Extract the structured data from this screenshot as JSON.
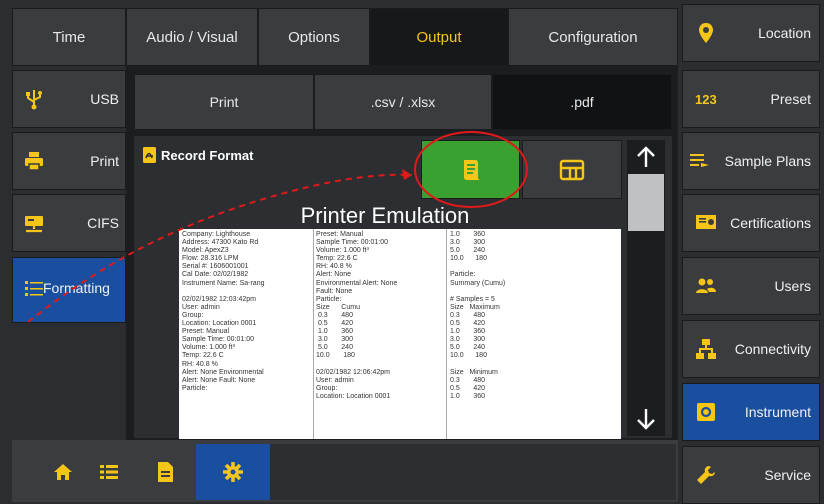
{
  "top_tabs": [
    {
      "label": "Time"
    },
    {
      "label": "Audio / Visual"
    },
    {
      "label": "Options"
    },
    {
      "label": "Output"
    },
    {
      "label": "Configuration"
    }
  ],
  "active_top_tab": "Output",
  "sub_tabs": [
    {
      "label": "Print"
    },
    {
      "label": ".csv / .xlsx"
    },
    {
      "label": ".pdf"
    }
  ],
  "active_sub_tab": ".pdf",
  "left_nav": [
    {
      "label": "USB",
      "icon": "usb-icon"
    },
    {
      "label": "Print",
      "icon": "printer-icon"
    },
    {
      "label": "CIFS",
      "icon": "network-drive-icon"
    },
    {
      "label": "Formatting",
      "icon": "formatting-list-icon"
    }
  ],
  "right_nav": [
    {
      "label": "Location",
      "icon": "location-pin-icon"
    },
    {
      "label": "Preset",
      "icon": "preset-123-icon"
    },
    {
      "label": "Sample Plans",
      "icon": "sample-plans-icon"
    },
    {
      "label": "Certifications",
      "icon": "certificate-icon"
    },
    {
      "label": "Users",
      "icon": "users-icon"
    },
    {
      "label": "Connectivity",
      "icon": "network-icon"
    },
    {
      "label": "Instrument",
      "icon": "gear-icon"
    },
    {
      "label": "Service",
      "icon": "wrench-icon"
    }
  ],
  "record_format": {
    "title": "Record Format",
    "heading": "Printer Emulation"
  },
  "doc_columns": [
    "Company: Lighthouse\nAddress: 47300 Kato Rd\nModel: ApexZ3\nFlow: 28.316 LPM\nSerial #: 1606001001\nCal Date: 02/02/1982\nInstrument Name: Sa-rang\n\n02/02/1982 12:03:42pm\nUser: admin\nGroup:\nLocation: Location 0001\nPreset: Manual\nSample Time: 00:01:00\nVolume: 1.000 ft³\nTemp: 22.6 C\nRH: 40.8 %\nAlert: None Environmental\nAlert: None Fault: None\nParticle:",
    "Preset: Manual\nSample Time: 00:01:00\nVolume: 1.000 ft³\nTemp: 22.6 C\nRH: 40.8 %\nAlert: None\nEnvironmental Alert: None\nFault: None\nParticle:\nSize      Cumu\n 0.3       480\n 0.5       420\n 1.0       360\n 3.0       300\n 5.0       240\n10.0       180\n\n02/02/1982 12:06:42pm\nUser: admin\nGroup:\nLocation: Location 0001",
    "1.0       360\n3.0       300\n5.0       240\n10.0      180\n\nParticle:\nSummary (Cumu)\n\n# Samples = 5\nSize   Maximum\n0.3       480\n0.5       420\n1.0       360\n3.0       300\n5.0       240\n10.0      180\n\nSize   Minimum\n0.3       480\n0.5       420\n1.0       360"
  ],
  "colors": {
    "accent_yellow": "#f5c518",
    "active_blue": "#1a4fa0",
    "green_button": "#3aa02f",
    "annotation_red": "#e11919"
  }
}
